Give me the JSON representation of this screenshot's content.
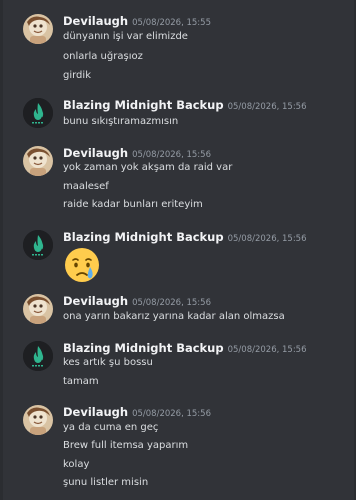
{
  "messages": [
    {
      "author": "Devilaugh",
      "time": "05/08/2026, 15:55",
      "lines": [
        "dünyanın işi var elimizde",
        "onlarla uğraşıoz",
        "girdik"
      ]
    },
    {
      "author": "Blazing Midnight Backup",
      "time": "05/08/2026, 15:56",
      "lines": [
        "bunu sıkıştıramazmısın"
      ]
    },
    {
      "author": "Devilaugh",
      "time": "05/08/2026, 15:56",
      "lines": [
        "yok zaman yok akşam da raid var",
        "maalesef",
        "raide kadar bunları eriteyim"
      ]
    },
    {
      "author": "Blazing Midnight Backup",
      "time": "05/08/2026, 15:56",
      "emoji": "crying-face-emoji"
    },
    {
      "author": "Devilaugh",
      "time": "05/08/2026, 15:56",
      "lines": [
        "ona yarın bakarız yarına kadar alan olmazsa"
      ]
    },
    {
      "author": "Blazing Midnight Backup",
      "time": "05/08/2026, 15:56",
      "lines": [
        "kes artık şu bossu",
        "tamam"
      ]
    },
    {
      "author": "Devilaugh",
      "time": "05/08/2026, 15:56",
      "lines": [
        "ya da cuma en geç",
        "Brew full itemsa yaparım",
        "kolay",
        "şunu listler misin"
      ]
    }
  ],
  "colors": {
    "background": "#313338",
    "username": "#f2f3f5",
    "timestamp": "#949ba4",
    "text": "#dbdee1",
    "bot_logo": "#2fb58e"
  }
}
